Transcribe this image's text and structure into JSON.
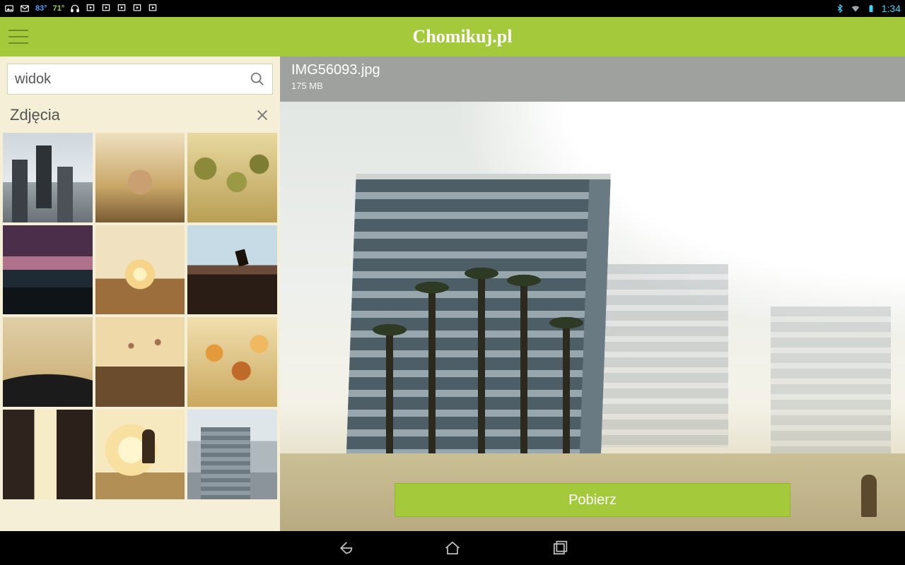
{
  "statusbar": {
    "temp1": "83°",
    "temp2": "71°",
    "clock": "1:34"
  },
  "app": {
    "title": "Chomikuj.pl"
  },
  "search": {
    "value": "widok"
  },
  "category": {
    "title": "Zdjęcia"
  },
  "file": {
    "name": "IMG56093.jpg",
    "size": "175 MB"
  },
  "actions": {
    "download": "Pobierz"
  }
}
